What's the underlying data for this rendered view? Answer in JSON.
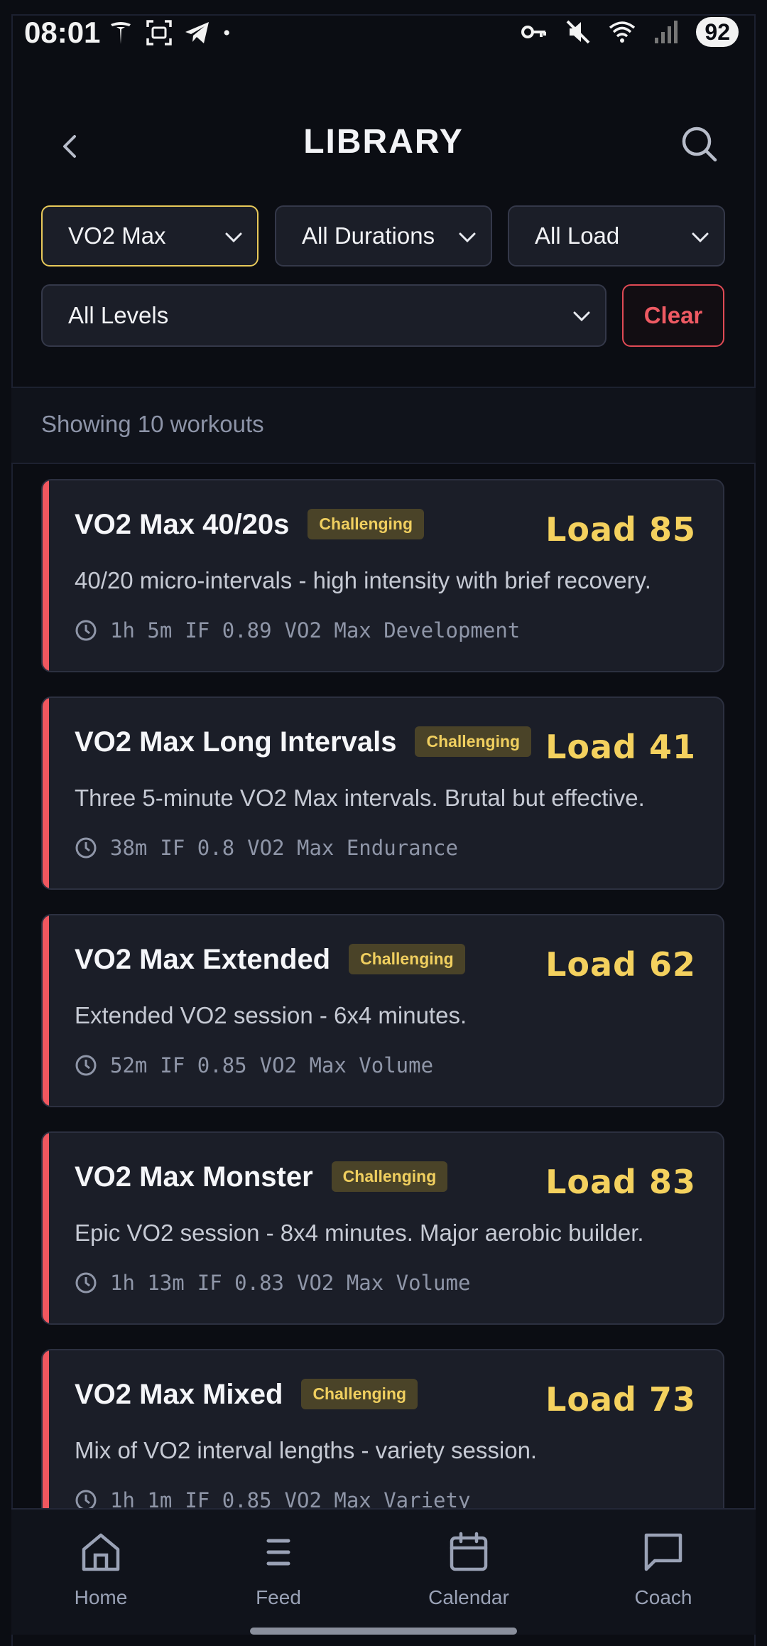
{
  "status_bar": {
    "time": "08:01",
    "left_icons": [
      "tesla-icon",
      "screenshot-icon",
      "telegram-icon",
      "dot-icon"
    ],
    "right_icons": [
      "key-icon",
      "mute-icon",
      "wifi-icon",
      "signal-icon"
    ],
    "battery": "92"
  },
  "header": {
    "title": "LIBRARY",
    "back_icon": "chevron-left-icon",
    "search_icon": "search-icon"
  },
  "filters": {
    "type": "VO2 Max",
    "duration": "All Durations",
    "load": "All Load",
    "level": "All Levels",
    "clear_label": "Clear"
  },
  "results": {
    "count_text": "Showing 10 workouts"
  },
  "workouts": [
    {
      "name": "VO2 Max 40/20s",
      "badge": "Challenging",
      "load": "Load 85",
      "description": "40/20 micro-intervals - high intensity with brief recovery.",
      "duration": "1h 5m",
      "if": "IF 0.89",
      "category": "VO2 Max Development"
    },
    {
      "name": "VO2 Max Long Intervals",
      "badge": "Challenging",
      "load": "Load 41",
      "description": "Three 5-minute VO2 Max intervals. Brutal but effective.",
      "duration": "38m",
      "if": "IF 0.8",
      "category": "VO2 Max Endurance"
    },
    {
      "name": "VO2 Max Extended",
      "badge": "Challenging",
      "load": "Load 62",
      "description": "Extended VO2 session - 6x4 minutes.",
      "duration": "52m",
      "if": "IF 0.85",
      "category": "VO2 Max Volume"
    },
    {
      "name": "VO2 Max Monster",
      "badge": "Challenging",
      "load": "Load 83",
      "description": "Epic VO2 session - 8x4 minutes. Major aerobic builder.",
      "duration": "1h 13m",
      "if": "IF 0.83",
      "category": "VO2 Max Volume"
    },
    {
      "name": "VO2 Max Mixed",
      "badge": "Challenging",
      "load": "Load 73",
      "description": "Mix of VO2 interval lengths - variety session.",
      "duration": "1h 1m",
      "if": "IF 0.85",
      "category": "VO2 Max Variety"
    }
  ],
  "nav": [
    {
      "label": "Home",
      "icon": "home-icon"
    },
    {
      "label": "Feed",
      "icon": "feed-icon"
    },
    {
      "label": "Calendar",
      "icon": "calendar-icon"
    },
    {
      "label": "Coach",
      "icon": "chat-icon"
    }
  ],
  "colors": {
    "accent_active": "#e8c95a",
    "danger": "#e04a55",
    "card_stripe": "#f0575f",
    "load_text": "#f4d15e",
    "badge_bg": "#4a4328"
  }
}
